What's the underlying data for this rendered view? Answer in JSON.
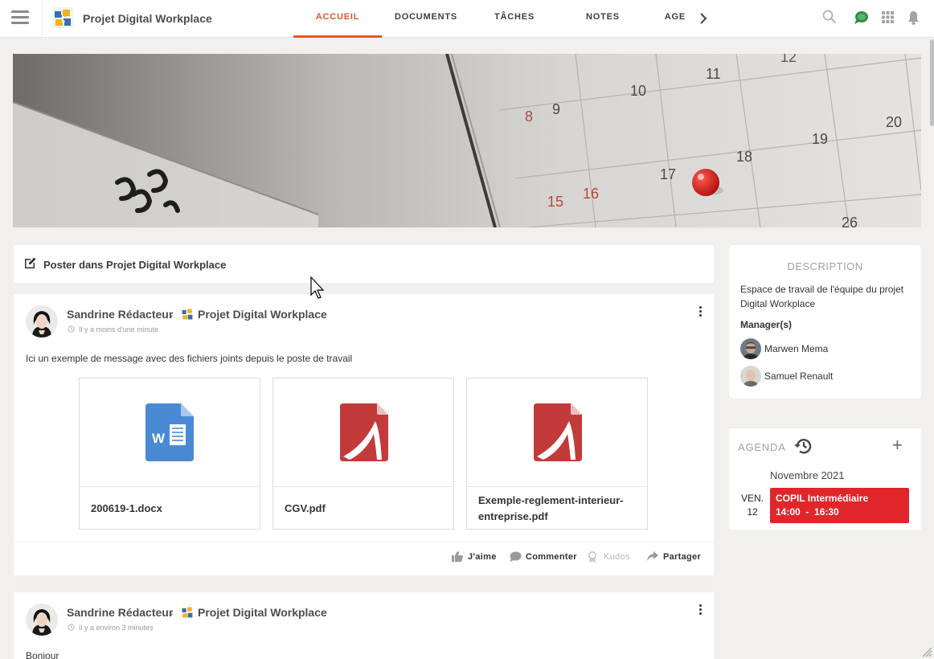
{
  "header": {
    "space_title": "Projet Digital Workplace",
    "tabs": [
      {
        "label": "ACCUEIL",
        "active": true
      },
      {
        "label": "DOCUMENTS",
        "active": false
      },
      {
        "label": "TÂCHES",
        "active": false
      },
      {
        "label": "NOTES",
        "active": false
      },
      {
        "label": "AGE",
        "active": false
      }
    ],
    "icons": [
      "menu-icon",
      "search-icon",
      "chat-icon",
      "apps-grid-icon",
      "bell-icon",
      "chevron-right-icon"
    ],
    "accent_color": "#e0592a"
  },
  "banner": {
    "calendar_numbers": [
      "12",
      "11",
      "10",
      "9",
      "8",
      "20",
      "19",
      "18",
      "17",
      "16",
      "15",
      "26"
    ]
  },
  "composer": {
    "label": "Poster dans Projet Digital Workplace"
  },
  "posts": [
    {
      "author": "Sandrine Rédacteur",
      "space": "Projet Digital Workplace",
      "time": "Il y a moins d'une minute",
      "text": "Ici un exemple de message avec des fichiers joints depuis le poste de travail",
      "attachments": [
        {
          "name": "200619-1.docx",
          "type": "word"
        },
        {
          "name": "CGV.pdf",
          "type": "pdf"
        },
        {
          "name": "Exemple-reglement-interieur-entreprise.pdf",
          "type": "pdf"
        }
      ],
      "actions": {
        "like": "J'aime",
        "comment": "Commenter",
        "kudos": "Kudos",
        "share": "Partager"
      }
    },
    {
      "author": "Sandrine Rédacteur",
      "space": "Projet Digital Workplace",
      "time": "Il y a environ 3 minutes",
      "text": "Bonjour"
    }
  ],
  "description": {
    "title": "DESCRIPTION",
    "text": "Espace de travail de l'équipe du projet Digital Workplace",
    "managers_label": "Manager(s)",
    "managers": [
      "Marwen Mema",
      "Samuel Renault"
    ]
  },
  "agenda": {
    "title": "AGENDA",
    "add_label": "+",
    "month": "Novembre 2021",
    "day_name": "VEN.",
    "day_num": "12",
    "event_title": "COPIL Intermédiaire",
    "event_time": "14:00  -  16:30",
    "event_color": "#e1262b"
  }
}
